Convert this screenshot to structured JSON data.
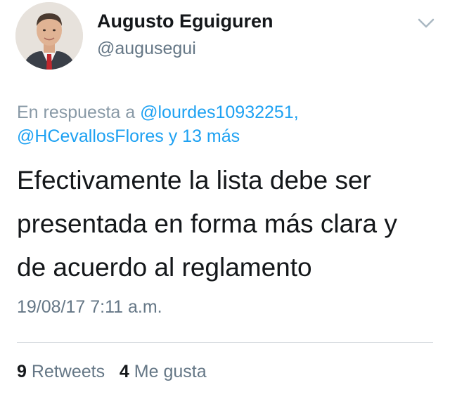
{
  "tweet": {
    "author": {
      "name": "Augusto Eguiguren",
      "handle": "@augusegui"
    },
    "reply": {
      "prefix": "En respuesta a",
      "mention1": "@lourdes10932251",
      "separator": ",",
      "mention2": "@HCevallosFlores",
      "others": "y 13 más"
    },
    "text": {
      "line1": "Efectivamente la lista debe ser",
      "line2": "presentada en forma más clara y",
      "line3": "de acuerdo al reglamento"
    },
    "timestamp": "19/08/17 7:11 a.m.",
    "stats": {
      "retweets_count": "9",
      "retweets_label": "Retweets",
      "likes_count": "4",
      "likes_label": "Me gusta"
    }
  },
  "icons": {
    "menu": "chevron-down-icon"
  },
  "colors": {
    "link": "#1da1f2",
    "secondary_text": "#657786",
    "primary_text": "#14171a"
  }
}
